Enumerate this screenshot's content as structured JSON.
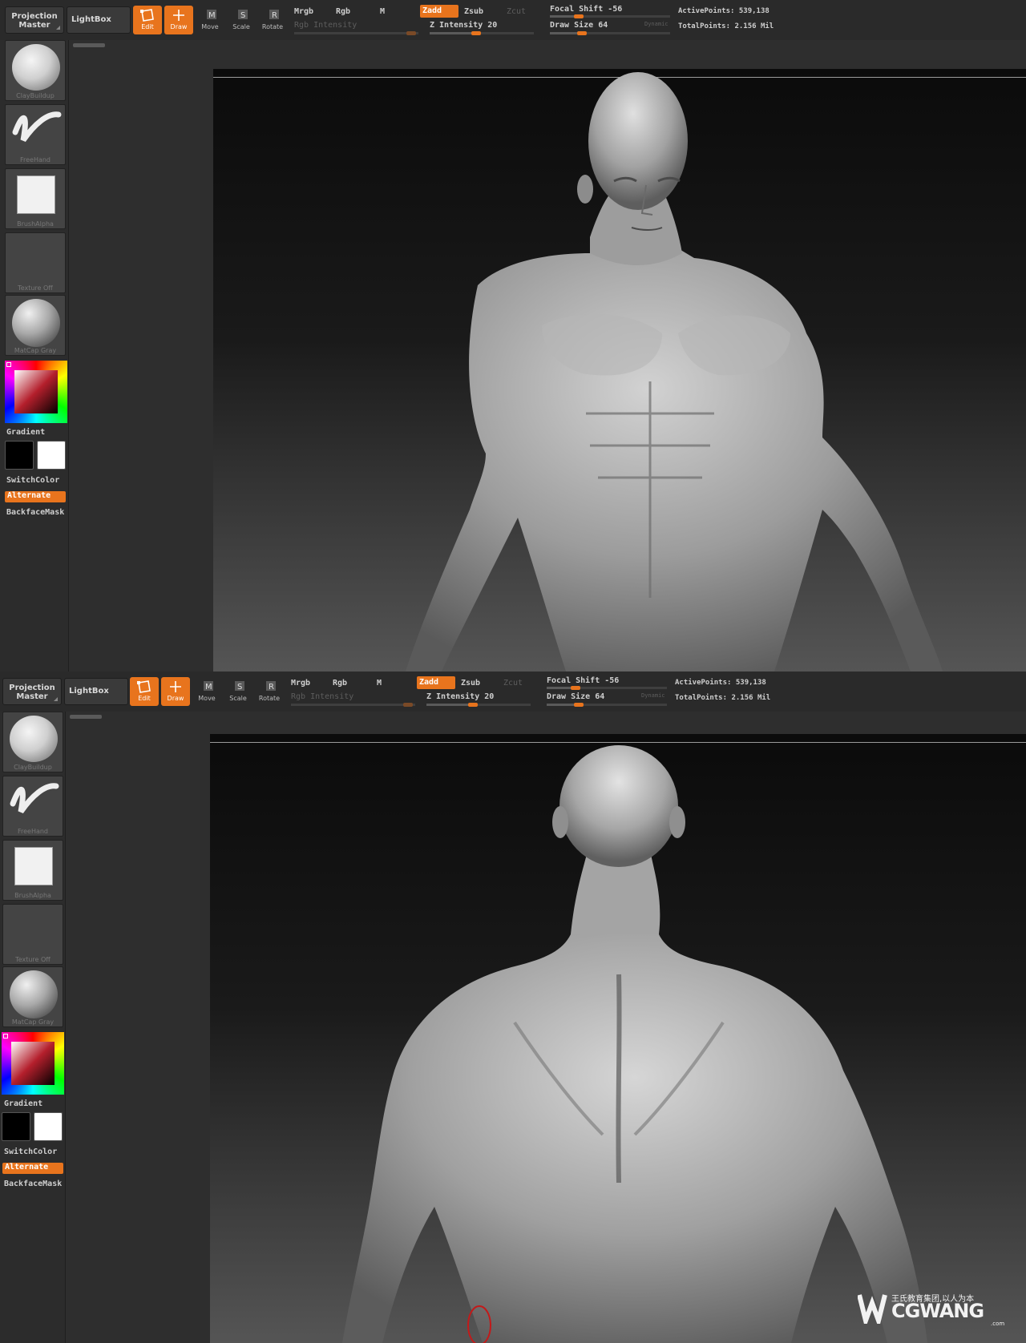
{
  "toolbar": {
    "projection_master": "Projection Master",
    "lightbox": "LightBox",
    "tools": [
      {
        "label": "Edit",
        "active": true
      },
      {
        "label": "Draw",
        "active": true
      },
      {
        "label": "Move",
        "active": false
      },
      {
        "label": "Scale",
        "active": false
      },
      {
        "label": "Rotate",
        "active": false
      }
    ],
    "mrgb": "Mrgb",
    "rgb": "Rgb",
    "m": "M",
    "zadd": "Zadd",
    "zsub": "Zsub",
    "zcut": "Zcut",
    "rgb_intensity": "Rgb Intensity",
    "z_intensity": "Z Intensity 20",
    "focal_shift": "Focal Shift -56",
    "draw_size": "Draw Size 64",
    "dynamic": "Dynamic",
    "active_points": "ActivePoints: 539,138",
    "total_points": "TotalPoints: 2.156 Mil"
  },
  "shelf": {
    "brush": "ClayBuildup",
    "stroke": "FreeHand",
    "alpha": "BrushAlpha",
    "texture": "Texture Off",
    "material": "MatCap Gray",
    "gradient": "Gradient",
    "switch_color": "SwitchColor",
    "alternate": "Alternate",
    "backface_mask": "BackfaceMask"
  },
  "colors": {
    "accent": "#e8741d",
    "main_color": "#000000",
    "secondary_color": "#ffffff"
  },
  "watermark": {
    "brand": "CGWANG",
    "tagline": "王氏教育集团,以人为本",
    "suffix": ".com"
  }
}
